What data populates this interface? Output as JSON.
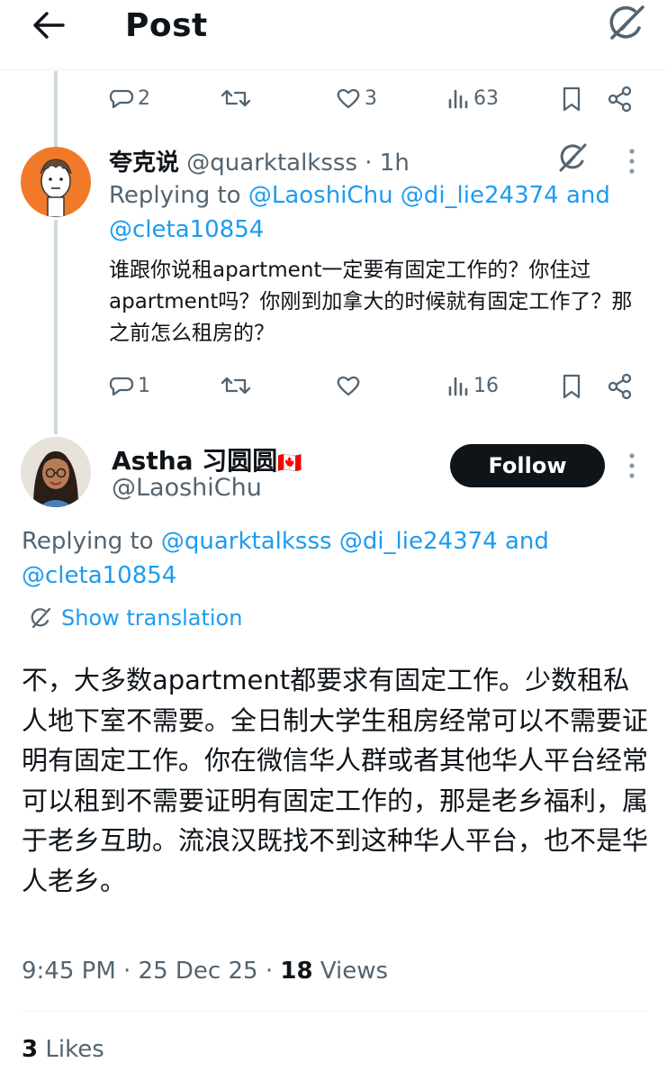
{
  "header": {
    "title": "Post",
    "back_icon": "back-arrow-icon",
    "grok_icon": "grok-icon"
  },
  "prev_tweet": {
    "actions": {
      "replies": "2",
      "reposts": "",
      "likes": "3",
      "views": "63"
    }
  },
  "reply_tweet": {
    "display_name": "夸克说",
    "handle": "@quarktalksss",
    "time": "· 1h",
    "replying_prefix": "Replying to",
    "replying_to_1": "@LaoshiChu @di_lie24374",
    "replying_and": "and",
    "replying_to_2": "@cleta10854",
    "body": "谁跟你说租apartment一定要有固定工作的？你住过apartment吗？你刚到加拿大的时候就有固定工作了？那之前怎么租房的？",
    "actions": {
      "replies": "1",
      "reposts": "",
      "likes": "",
      "views": "16"
    }
  },
  "main_tweet": {
    "display_name": "Astha 习圆圆",
    "flag": "🇨🇦",
    "handle": "@LaoshiChu",
    "follow_label": "Follow",
    "replying_prefix": "Replying to",
    "replying_to_1": "@quarktalksss @di_lie24374",
    "replying_and": "and",
    "replying_to_2": "@cleta10854",
    "show_translation": "Show translation",
    "body": "不，大多数apartment都要求有固定工作。少数租私人地下室不需要。全日制大学生租房经常可以不需要证明有固定工作。你在微信华人群或者其他华人平台经常可以租到不需要证明有固定工作的，那是老乡福利，属于老乡互助。流浪汉既找不到这种华人平台，也不是华人老乡。",
    "time": "9:45 PM · 25 Dec 25 ·",
    "views_count": "18",
    "views_label": "Views",
    "likes_count": "3",
    "likes_label": "Likes"
  },
  "colors": {
    "accent": "#1d9bf0",
    "text": "#0f1419",
    "muted": "#536471",
    "follow_bg": "#0f1419"
  }
}
